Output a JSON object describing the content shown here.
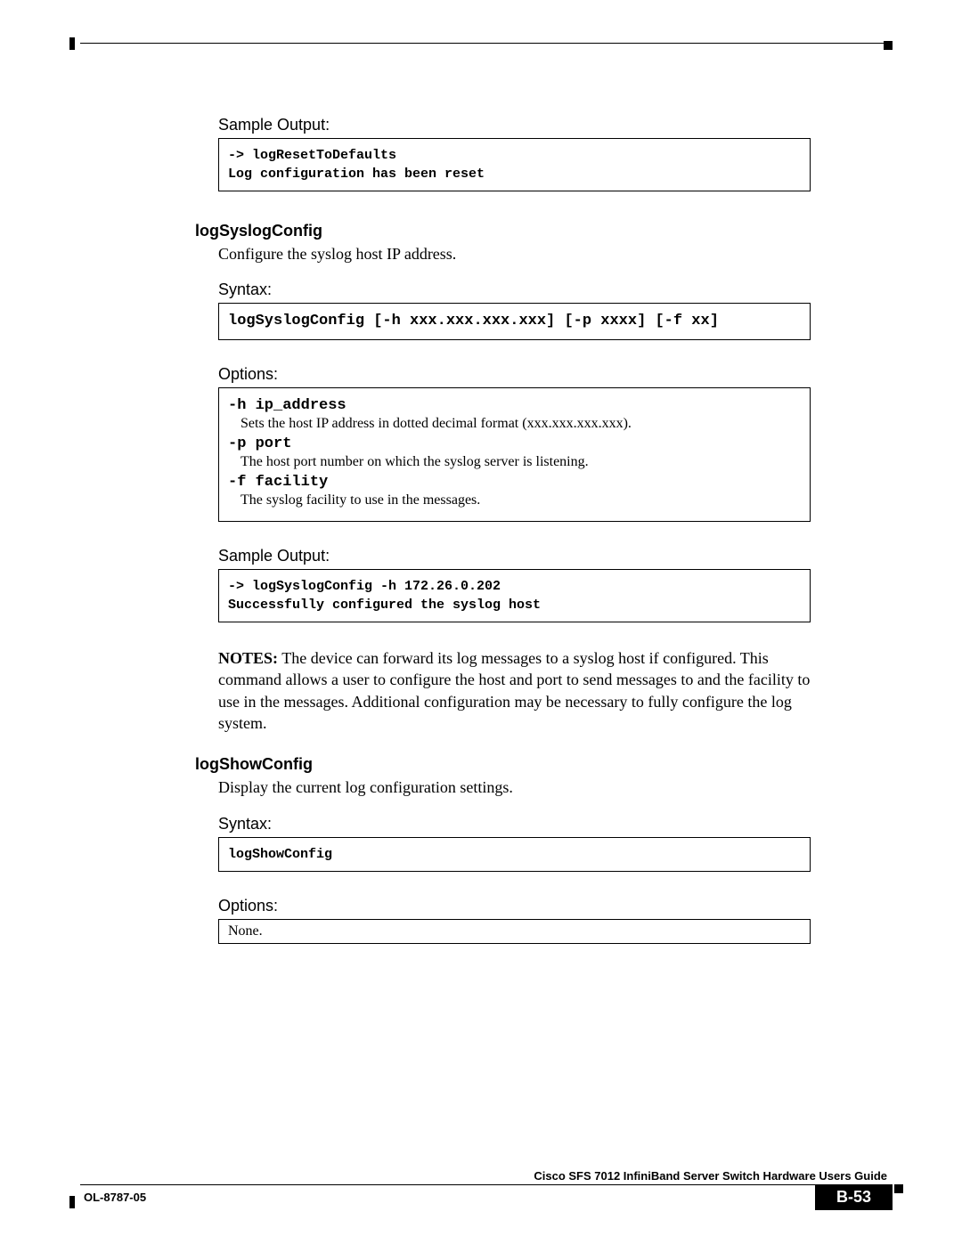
{
  "sections": [
    {
      "label": "Sample Output:",
      "code": [
        "-> logResetToDefaults",
        "Log configuration has been reset"
      ]
    },
    {
      "heading": "logSyslogConfig",
      "desc": "Configure the syslog host IP address.",
      "syntax_label": "Syntax:",
      "syntax": "logSyslogConfig [-h xxx.xxx.xxx.xxx] [-p xxxx] [-f xx]",
      "options_label": "Options:",
      "options": [
        {
          "flag": "-h ip_address",
          "desc": "Sets the host IP address in dotted decimal format (xxx.xxx.xxx.xxx)."
        },
        {
          "flag": "-p port",
          "desc": "The host port number on which the syslog server is listening."
        },
        {
          "flag": "-f facility",
          "desc": "The syslog facility to use in the messages."
        }
      ],
      "sample_label": "Sample Output:",
      "sample": [
        "-> logSyslogConfig -h 172.26.0.202",
        "Successfully configured the syslog host"
      ],
      "notes_label": "NOTES:",
      "notes": "The device can forward its log messages to a syslog host if configured. This command allows a user to configure the host and port to send messages to and the facility to use in the messages. Additional configuration may be necessary to fully configure the log system."
    },
    {
      "heading": "logShowConfig",
      "desc": "Display the current log configuration settings.",
      "syntax_label": "Syntax:",
      "syntax": "logShowConfig",
      "options_label": "Options:",
      "options_text": "None."
    }
  ],
  "footer": {
    "doc_title": "Cisco SFS 7012 InfiniBand Server Switch Hardware Users Guide",
    "doc_id": "OL-8787-05",
    "page": "B-53"
  }
}
